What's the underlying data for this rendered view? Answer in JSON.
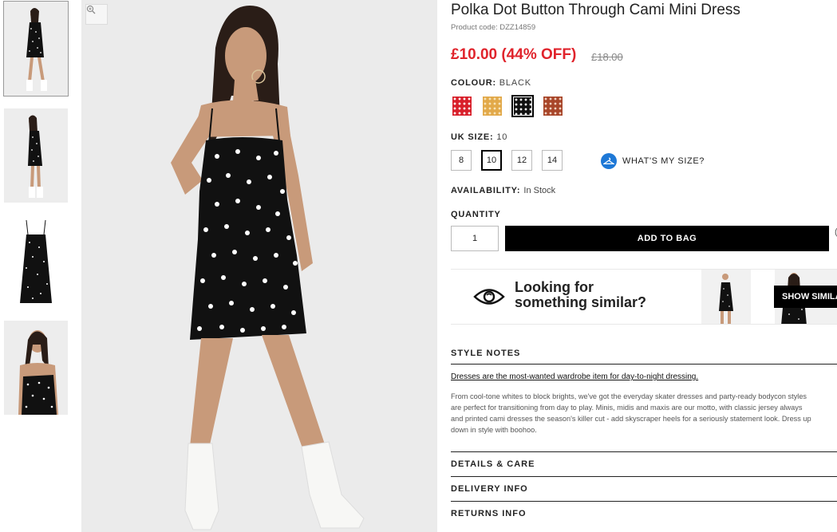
{
  "product": {
    "title": "Polka Dot Button Through Cami Mini Dress",
    "code": "Product code: DZZ14859",
    "price": "£10.00 (44% OFF)",
    "old_price": "£18.00"
  },
  "colour": {
    "label": "COLOUR:",
    "value": "BLACK",
    "swatches": [
      {
        "name": "Red",
        "color": "#d8202b",
        "dot": "#ffffff"
      },
      {
        "name": "Mustard",
        "color": "#e2a94a",
        "dot": "#f7e3b8"
      },
      {
        "name": "Black",
        "color": "#111111",
        "dot": "#ffffff",
        "selected": true
      },
      {
        "name": "Rust",
        "color": "#a8462a",
        "dot": "#f0d2c2"
      }
    ]
  },
  "size": {
    "label": "UK SIZE:",
    "value": "10",
    "options": [
      "8",
      "10",
      "12",
      "14"
    ],
    "selected": "10",
    "help_label": "WHAT'S MY SIZE?"
  },
  "availability": {
    "label": "AVAILABILITY:",
    "value": "In Stock"
  },
  "quantity": {
    "label": "QUANTITY",
    "value": "1"
  },
  "add_to_bag": "ADD TO BAG",
  "wishlist_edge": "(",
  "similar": {
    "line1": "Looking for",
    "line2": "something similar?",
    "button": "SHOW SIMILA"
  },
  "style_notes": {
    "heading": "STYLE NOTES",
    "lead": "Dresses are the most-wanted wardrobe item for day-to-night dressing.",
    "body_lines": [
      "From cool-tone whites to block brights, we've got the everyday skater dresses and party-ready bodycon styles",
      "are perfect for transitioning from day to play. Minis, midis and maxis are our motto, with classic jersey always",
      "and printed cami dresses the season's killer cut - add skyscraper heels for a seriously statement look. Dress up",
      "down in style with boohoo."
    ]
  },
  "sections": {
    "details": "DETAILS & CARE",
    "delivery": "DELIVERY INFO",
    "returns": "RETURNS INFO"
  },
  "colors": {
    "accent_red": "#e0242c",
    "button_black": "#000000",
    "size_help_blue": "#1e78d6"
  }
}
